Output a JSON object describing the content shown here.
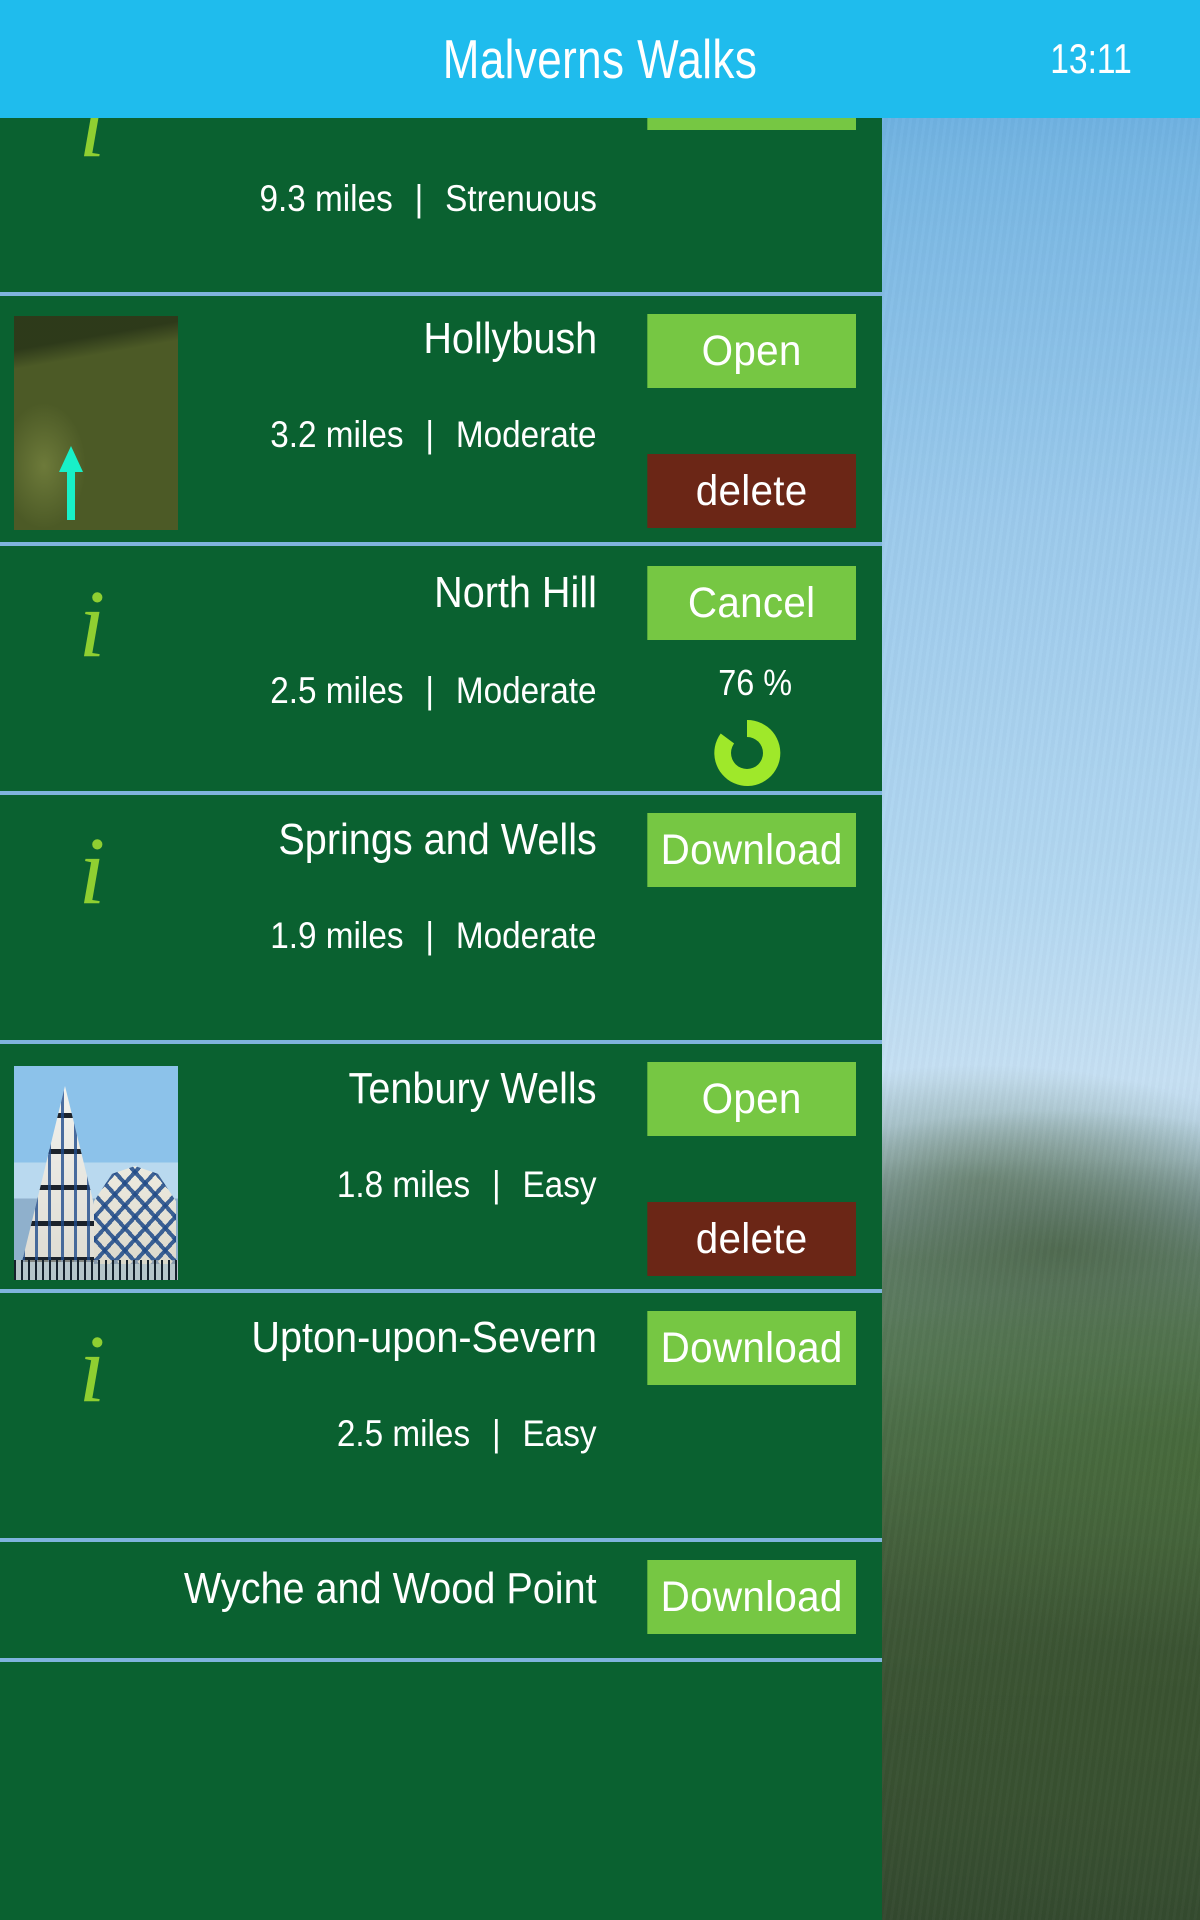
{
  "app": {
    "title": "Malverns Walks",
    "clock": "13:11",
    "accent_blue": "#1fbced",
    "panel_green": "#0a6130",
    "button_green": "#76c743",
    "button_red": "#6b2616",
    "icon_green": "#8fcf31",
    "divider_blue": "#7fb4dd",
    "spinner_green": "#9fe82a"
  },
  "walks": [
    {
      "name": "",
      "distance": "9.3 miles",
      "difficulty": "Strenuous",
      "icon": "info-icon",
      "state": "partial-top",
      "primary_action": ""
    },
    {
      "name": "Hollybush",
      "distance": "3.2 miles",
      "difficulty": "Moderate",
      "icon": "thumbnail-photo",
      "state": "downloaded",
      "primary_action": "Open",
      "secondary_action": "delete"
    },
    {
      "name": "North Hill",
      "distance": "2.5 miles",
      "difficulty": "Moderate",
      "icon": "info-icon",
      "state": "downloading",
      "primary_action": "Cancel",
      "progress_label": "76 %",
      "progress_value": 76
    },
    {
      "name": "Springs and Wells",
      "distance": "1.9 miles",
      "difficulty": "Moderate",
      "icon": "info-icon",
      "state": "available",
      "primary_action": "Download"
    },
    {
      "name": "Tenbury Wells",
      "distance": "1.8 miles",
      "difficulty": "Easy",
      "icon": "thumbnail-photo",
      "state": "downloaded",
      "primary_action": "Open",
      "secondary_action": "delete"
    },
    {
      "name": "Upton-upon-Severn",
      "distance": "2.5 miles",
      "difficulty": "Easy",
      "icon": "info-icon",
      "state": "available",
      "primary_action": "Download"
    },
    {
      "name": "Wyche and Wood Point",
      "distance": "",
      "difficulty": "",
      "icon": "info-icon",
      "state": "available",
      "primary_action": "Download"
    }
  ],
  "separator": "|"
}
